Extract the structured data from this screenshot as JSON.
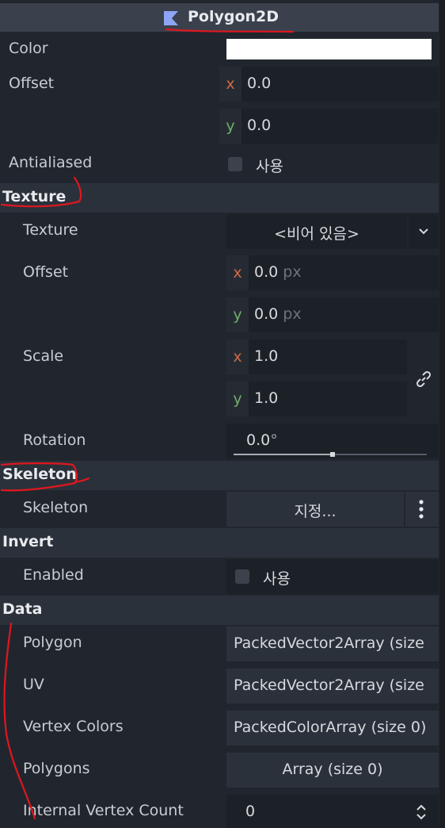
{
  "header": {
    "title": "Polygon2D",
    "icon": "polygon2d-icon"
  },
  "rows": {
    "color_label": "Color",
    "offset_label": "Offset",
    "offset_x": "0.0",
    "offset_y": "0.0",
    "antialiased_label": "Antialiased",
    "antialiased_value": "사용"
  },
  "axes": {
    "x": "x",
    "y": "y"
  },
  "texture": {
    "section": "Texture",
    "texture_label": "Texture",
    "texture_value": "<비어 있음>",
    "offset_label": "Offset",
    "offset_x": "0.0",
    "offset_y": "0.0",
    "unit": "px",
    "scale_label": "Scale",
    "scale_x": "1.0",
    "scale_y": "1.0",
    "rotation_label": "Rotation",
    "rotation_value": "0.0",
    "rotation_unit": "°"
  },
  "skeleton": {
    "section": "Skeleton",
    "skeleton_label": "Skeleton",
    "skeleton_value": "지정..."
  },
  "invert": {
    "section": "Invert",
    "enabled_label": "Enabled",
    "enabled_value": "사용"
  },
  "data": {
    "section": "Data",
    "polygon_label": "Polygon",
    "polygon_value": "PackedVector2Array (size",
    "uv_label": "UV",
    "uv_value": "PackedVector2Array (size",
    "vertex_colors_label": "Vertex Colors",
    "vertex_colors_value": "PackedColorArray (size 0)",
    "polygons_label": "Polygons",
    "polygons_value": "Array (size 0)",
    "ivc_label": "Internal Vertex Count",
    "ivc_value": "0"
  },
  "colors": {
    "background": "#21262e",
    "section_bg": "#2b313a",
    "field_bg": "#1c2128",
    "axis_x": "#d06848",
    "axis_y": "#6fae6c",
    "annotation": "#e0161f",
    "color_swatch": "#ffffff"
  }
}
